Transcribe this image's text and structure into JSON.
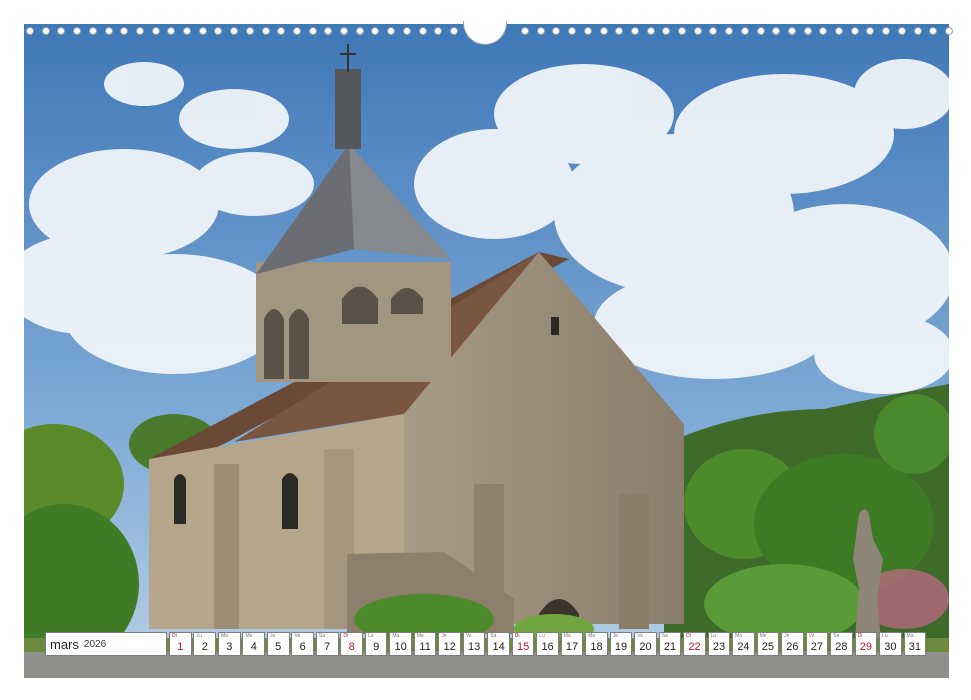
{
  "calendar": {
    "month": "mars",
    "year": "2026",
    "days": [
      {
        "dow": "Di",
        "num": "1",
        "sunday": true
      },
      {
        "dow": "Lu",
        "num": "2"
      },
      {
        "dow": "Ma",
        "num": "3"
      },
      {
        "dow": "Me",
        "num": "4"
      },
      {
        "dow": "Je",
        "num": "5"
      },
      {
        "dow": "Ve",
        "num": "6"
      },
      {
        "dow": "Sa",
        "num": "7"
      },
      {
        "dow": "Di",
        "num": "8",
        "sunday": true
      },
      {
        "dow": "Lu",
        "num": "9"
      },
      {
        "dow": "Ma",
        "num": "10"
      },
      {
        "dow": "Me",
        "num": "11"
      },
      {
        "dow": "Je",
        "num": "12"
      },
      {
        "dow": "Ve",
        "num": "13"
      },
      {
        "dow": "Sa",
        "num": "14"
      },
      {
        "dow": "Di",
        "num": "15",
        "sunday": true
      },
      {
        "dow": "Lu",
        "num": "16"
      },
      {
        "dow": "Ma",
        "num": "17"
      },
      {
        "dow": "Me",
        "num": "18"
      },
      {
        "dow": "Je",
        "num": "19"
      },
      {
        "dow": "Ve",
        "num": "20"
      },
      {
        "dow": "Sa",
        "num": "21"
      },
      {
        "dow": "Di",
        "num": "22",
        "sunday": true
      },
      {
        "dow": "Lu",
        "num": "23"
      },
      {
        "dow": "Ma",
        "num": "24"
      },
      {
        "dow": "Me",
        "num": "25"
      },
      {
        "dow": "Je",
        "num": "26"
      },
      {
        "dow": "Ve",
        "num": "27"
      },
      {
        "dow": "Sa",
        "num": "28"
      },
      {
        "dow": "Di",
        "num": "29",
        "sunday": true
      },
      {
        "dow": "Lu",
        "num": "30"
      },
      {
        "dow": "Ma",
        "num": "31"
      }
    ]
  },
  "colors": {
    "sunday": "#c8102e",
    "border": "#7d7d7d",
    "sky": "#4f87c3"
  },
  "photo": {
    "subject": "church-icon"
  }
}
